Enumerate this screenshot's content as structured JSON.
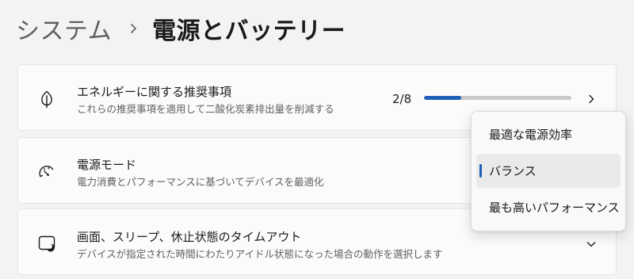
{
  "breadcrumb": {
    "parent": "システム",
    "separator_icon": "chevron-right-icon",
    "current": "電源とバッテリー"
  },
  "cards": {
    "energy": {
      "icon": "leaf-icon",
      "title": "エネルギーに関する推奨事項",
      "description": "これらの推奨事項を適用して二酸化炭素排出量を削減する",
      "progress_text": "2/8",
      "progress_fraction": 0.25,
      "chevron": "chevron-right-icon"
    },
    "power_mode": {
      "icon": "speedometer-icon",
      "title": "電源モード",
      "description": "電力消費とパフォーマンスに基づいてデバイスを最適化"
    },
    "sleep": {
      "icon": "screen-sleep-icon",
      "title": "画面、スリープ、休止状態のタイムアウト",
      "description": "デバイスが指定された時間にわたりアイドル状態になった場合の動作を選択します",
      "chevron": "chevron-down-icon"
    }
  },
  "power_mode_dropdown": {
    "options": [
      "最適な電源効率",
      "バランス",
      "最も高いパフォーマンス"
    ],
    "selected": "バランス"
  },
  "colors": {
    "accent": "#1e60b8",
    "background": "#f3f3f3",
    "card": "#fbfbfb"
  }
}
